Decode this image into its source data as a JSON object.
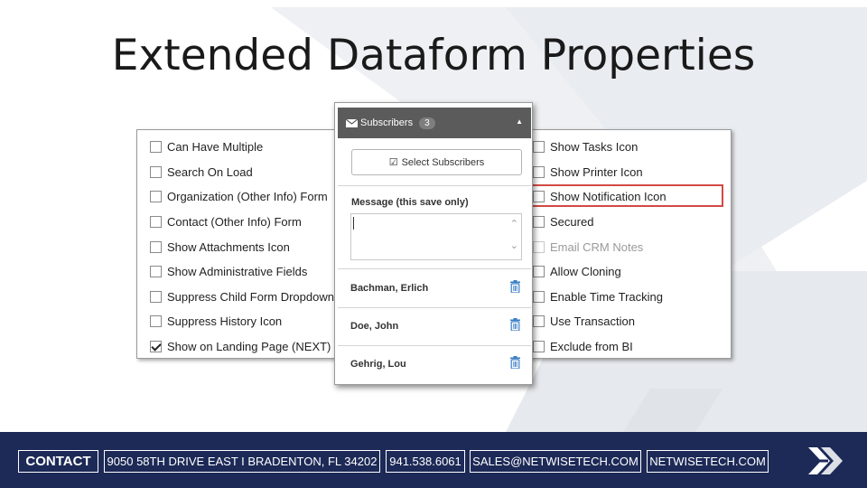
{
  "slide": {
    "title": "Extended Dataform Properties"
  },
  "options_left": [
    {
      "label": "Can Have Multiple",
      "checked": false
    },
    {
      "label": "Search On Load",
      "checked": false
    },
    {
      "label": "Organization (Other Info) Form",
      "checked": false
    },
    {
      "label": "Contact (Other Info) Form",
      "checked": false
    },
    {
      "label": "Show Attachments Icon",
      "checked": false
    },
    {
      "label": "Show Administrative Fields",
      "checked": false
    },
    {
      "label": "Suppress Child Form Dropdown",
      "checked": false
    },
    {
      "label": "Suppress History Icon",
      "checked": false
    },
    {
      "label": "Show on Landing Page (NEXT)",
      "checked": true
    }
  ],
  "options_right": [
    {
      "label": "Show Tasks Icon"
    },
    {
      "label": "Show Printer Icon"
    },
    {
      "label": "Show Notification Icon",
      "highlighted": true
    },
    {
      "label": "Secured"
    },
    {
      "label": "Email CRM Notes",
      "disabled": true
    },
    {
      "label": "Allow Cloning"
    },
    {
      "label": "Enable Time Tracking"
    },
    {
      "label": "Use Transaction"
    },
    {
      "label": "Exclude from BI"
    }
  ],
  "subscribers_popup": {
    "header_label": "Subscribers",
    "count": "3",
    "select_button": "Select Subscribers",
    "message_label": "Message (this save only)",
    "message_value": "",
    "subscribers": [
      {
        "name": "Bachman, Erlich"
      },
      {
        "name": "Doe, John"
      },
      {
        "name": "Gehrig, Lou"
      }
    ]
  },
  "footer": {
    "contact_label": "CONTACT",
    "address": "9050 58TH DRIVE EAST I BRADENTON, FL 34202",
    "phone": "941.538.6061",
    "email": "SALES@NETWISETECH.COM",
    "website": "NETWISETECH.COM"
  },
  "colors": {
    "footer_navy": "#1d2a57",
    "highlight_red": "#d24a43",
    "popup_header": "#5b5b5b",
    "trash_blue": "#3a7fc4"
  }
}
